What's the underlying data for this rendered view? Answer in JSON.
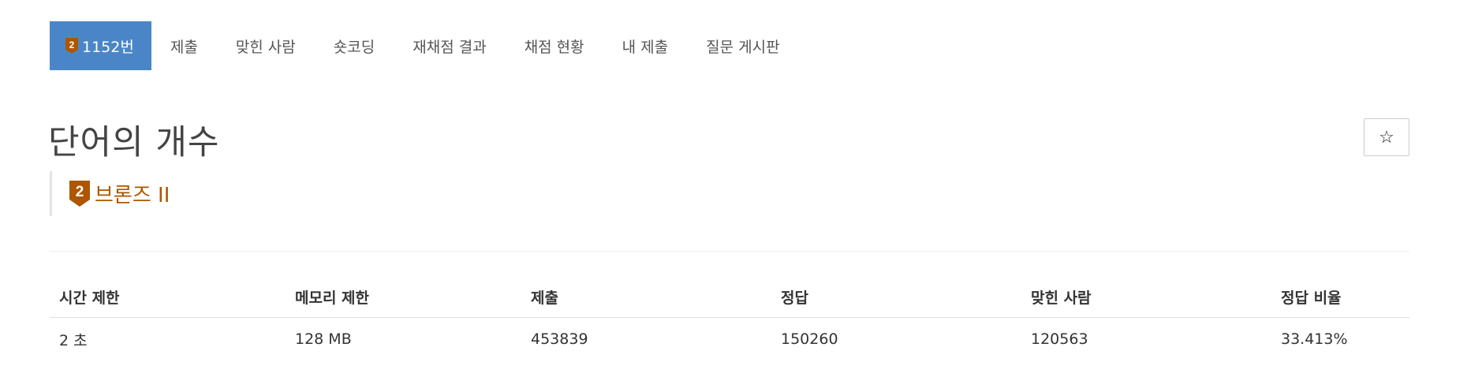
{
  "tabs": [
    {
      "label": "1152번",
      "active": true,
      "icon": "tier-badge-icon"
    },
    {
      "label": "제출"
    },
    {
      "label": "맞힌 사람"
    },
    {
      "label": "숏코딩"
    },
    {
      "label": "재채점 결과"
    },
    {
      "label": "채점 현황"
    },
    {
      "label": "내 제출"
    },
    {
      "label": "질문 게시판"
    }
  ],
  "problem": {
    "title": "단어의 개수",
    "star_icon": "☆",
    "tier": {
      "level": "2",
      "name": "브론즈 II",
      "color": "#ad5600"
    }
  },
  "table": {
    "headers": [
      "시간 제한",
      "메모리 제한",
      "제출",
      "정답",
      "맞힌 사람",
      "정답 비율"
    ],
    "row": [
      "2 초",
      "128 MB",
      "453839",
      "150260",
      "120563",
      "33.413%"
    ]
  },
  "colors": {
    "accent": "#4a86c7",
    "bronze": "#ad5600"
  }
}
